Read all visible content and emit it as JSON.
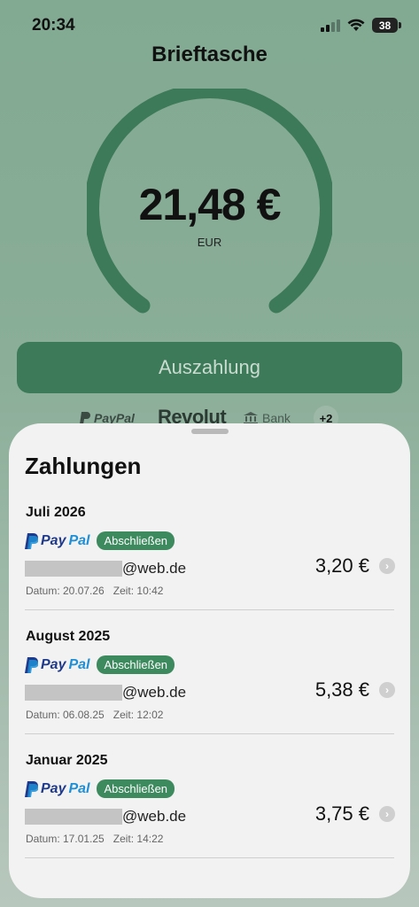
{
  "status_bar": {
    "time": "20:34",
    "battery": "38"
  },
  "header": {
    "title": "Brieftasche"
  },
  "balance": {
    "amount": "21,48 €",
    "currency": "EUR"
  },
  "payout_button": {
    "label": "Auszahlung"
  },
  "providers": {
    "paypal": "PayPal",
    "revolut": "Revolut",
    "bank": "Bank",
    "more": "+2"
  },
  "payments": {
    "title": "Zahlungen",
    "items": [
      {
        "month": "Juli 2026",
        "provider_pay": "Pay",
        "provider_pal": "Pal",
        "badge": "Abschließen",
        "email_domain": "@web.de",
        "amount": "3,20 €",
        "date": "Datum: 20.07.26",
        "time": "Zeit: 10:42"
      },
      {
        "month": "August 2025",
        "provider_pay": "Pay",
        "provider_pal": "Pal",
        "badge": "Abschließen",
        "email_domain": "@web.de",
        "amount": "5,38 €",
        "date": "Datum: 06.08.25",
        "time": "Zeit: 12:02"
      },
      {
        "month": "Januar 2025",
        "provider_pay": "Pay",
        "provider_pal": "Pal",
        "badge": "Abschließen",
        "email_domain": "@web.de",
        "amount": "3,75 €",
        "date": "Datum: 17.01.25",
        "time": "Zeit: 14:22"
      }
    ]
  },
  "colors": {
    "accent": "#3d7a59",
    "badge": "#3d8a5f",
    "background": "#82a992",
    "sheet": "#f2f2f2"
  },
  "icons": {
    "wifi": "wifi-icon",
    "signal": "signal-icon",
    "battery": "battery-icon",
    "bank": "bank-icon",
    "chevron": "chevron-right-icon"
  }
}
